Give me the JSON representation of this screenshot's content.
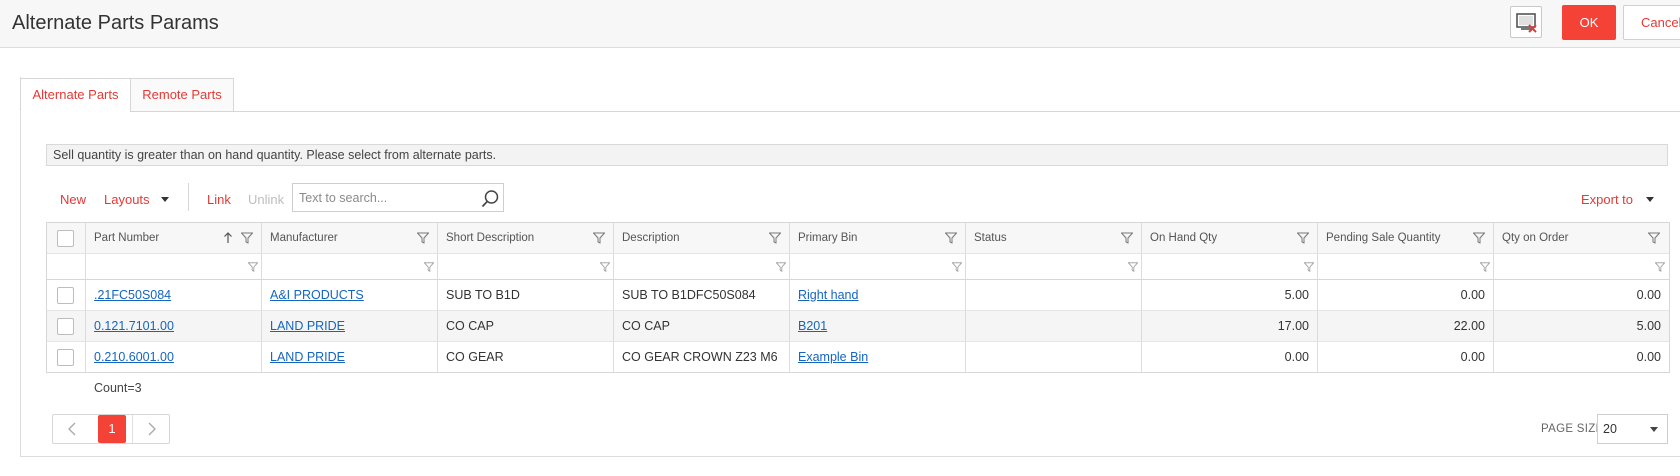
{
  "header": {
    "title": "Alternate Parts Params",
    "preview_icon": "print-preview-icon",
    "ok_label": "OK",
    "cancel_label": "Cancel",
    "accent_color": "#f44336"
  },
  "tabs": [
    {
      "label": "Alternate Parts",
      "active": true
    },
    {
      "label": "Remote Parts",
      "active": false
    }
  ],
  "message": "Sell quantity is greater than on hand quantity. Please select from alternate parts.",
  "toolbar": {
    "new_label": "New",
    "layouts_label": "Layouts",
    "link_label": "Link",
    "unlink_label": "Unlink",
    "search_placeholder": "Text to search...",
    "export_label": "Export to"
  },
  "grid": {
    "columns": [
      "Part Number",
      "Manufacturer",
      "Short Description",
      "Description",
      "Primary Bin",
      "Status",
      "On Hand Qty",
      "Pending Sale Quantity",
      "Qty on Order"
    ],
    "sort_column": "Part Number",
    "sort_direction": "ascending",
    "rows": [
      {
        "part_number": ".21FC50S084",
        "manufacturer": "A&I PRODUCTS",
        "short_description": "SUB TO B1D",
        "description": "SUB TO B1DFC50S084",
        "primary_bin": "Right hand",
        "status": "",
        "on_hand_qty": "5.00",
        "pending_sale_qty": "0.00",
        "qty_on_order": "0.00"
      },
      {
        "part_number": "0.121.7101.00",
        "manufacturer": "LAND PRIDE",
        "short_description": "CO CAP",
        "description": "CO CAP",
        "primary_bin": "B201",
        "status": "",
        "on_hand_qty": "17.00",
        "pending_sale_qty": "22.00",
        "qty_on_order": "5.00"
      },
      {
        "part_number": "0.210.6001.00",
        "manufacturer": "LAND PRIDE",
        "short_description": "CO GEAR",
        "description": "CO GEAR CROWN Z23 M6",
        "primary_bin": "Example Bin",
        "status": "",
        "on_hand_qty": "0.00",
        "pending_sale_qty": "0.00",
        "qty_on_order": "0.00"
      }
    ],
    "count_text": "Count=3"
  },
  "pagination": {
    "current_page": "1",
    "page_size_label": "PAGE SIZE",
    "page_size": "20"
  }
}
